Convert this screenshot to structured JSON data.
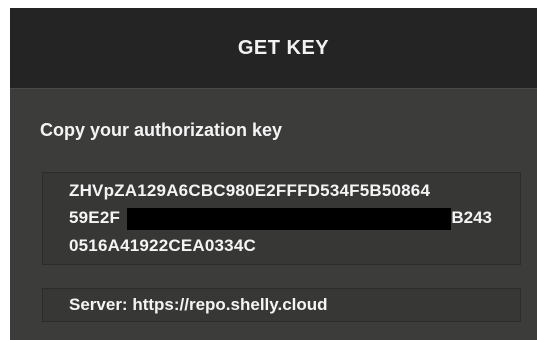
{
  "header": {
    "title": "GET KEY"
  },
  "instruction": "Copy your authorization key",
  "key": {
    "line1": "ZHVpZA129A6CBC980E2FFFD534F5B50864",
    "line2_start": "59E2F",
    "line2_end": "B243",
    "line3": "0516A41922CEA0334C"
  },
  "server": {
    "text": "Server: https://repo.shelly.cloud"
  },
  "colors": {
    "background": "#3c3d3b",
    "header": "#242424",
    "field": "#373836",
    "text": "#f4f4f4",
    "redaction": "#000000"
  }
}
